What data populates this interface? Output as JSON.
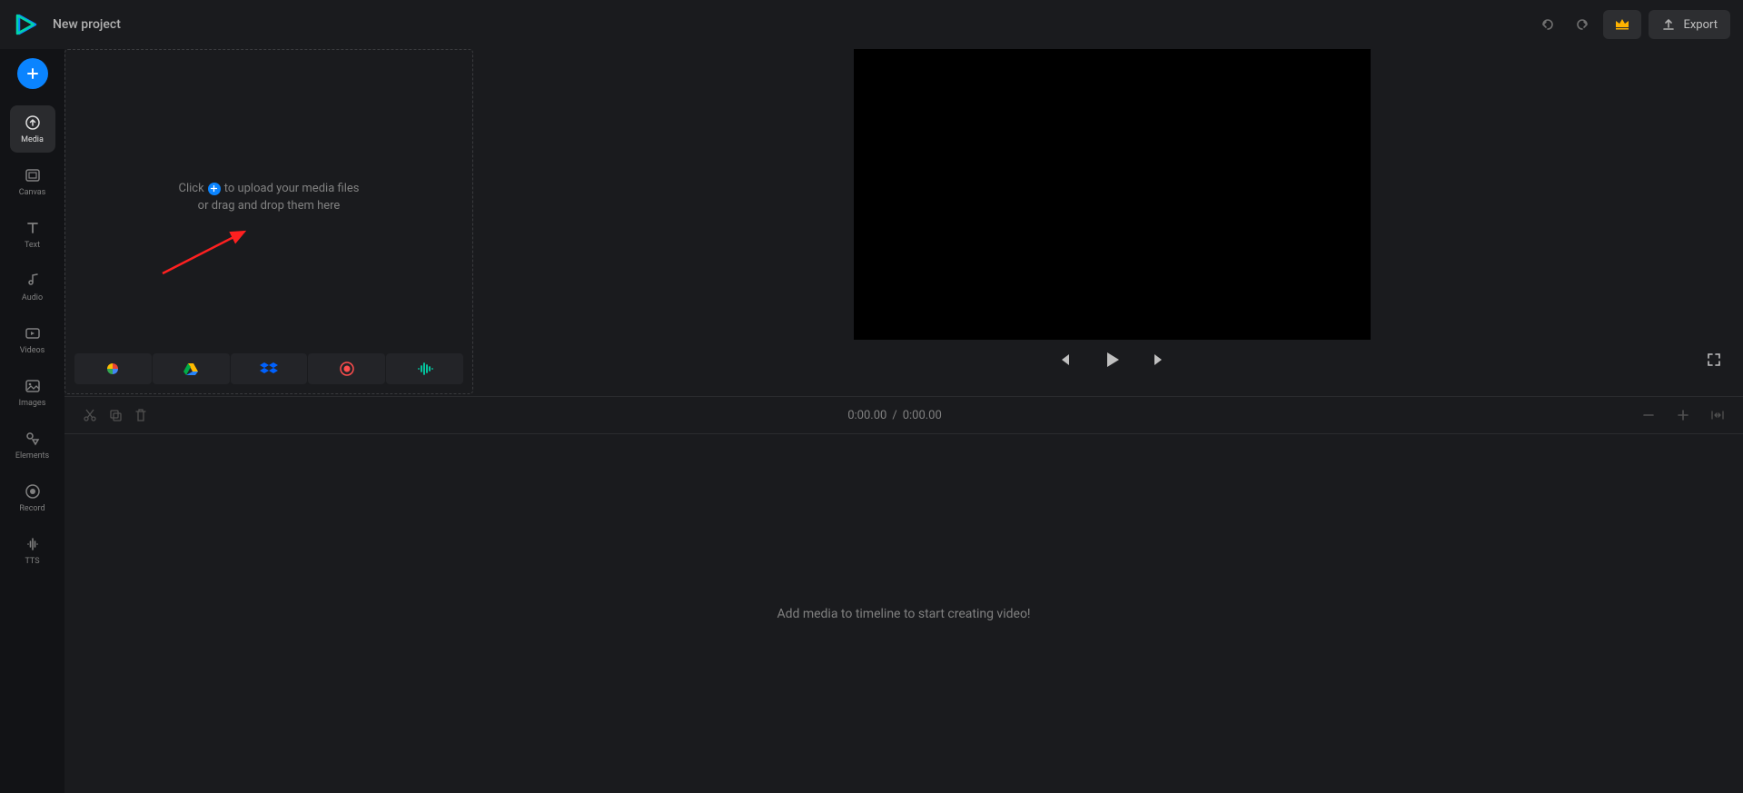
{
  "header": {
    "title": "New project",
    "export_label": "Export"
  },
  "sidebar": {
    "items": [
      {
        "label": "Media"
      },
      {
        "label": "Canvas"
      },
      {
        "label": "Text"
      },
      {
        "label": "Audio"
      },
      {
        "label": "Videos"
      },
      {
        "label": "Images"
      },
      {
        "label": "Elements"
      },
      {
        "label": "Record"
      },
      {
        "label": "TTS"
      }
    ],
    "active_index": 0
  },
  "dropzone": {
    "line1_prefix": "Click",
    "line1_suffix": "to upload your media files",
    "line2": "or drag and drop them here"
  },
  "upload_sources": [
    {
      "name": "google-photos"
    },
    {
      "name": "google-drive"
    },
    {
      "name": "dropbox"
    },
    {
      "name": "record"
    },
    {
      "name": "audio-wave"
    }
  ],
  "timecode": {
    "current": "0:00.00",
    "separator": "/",
    "total": "0:00.00"
  },
  "timeline": {
    "empty_message": "Add media to timeline to start creating video!"
  },
  "colors": {
    "accent": "#0a84ff",
    "crown": "#ffb300",
    "annotation_arrow": "#ff2020"
  }
}
